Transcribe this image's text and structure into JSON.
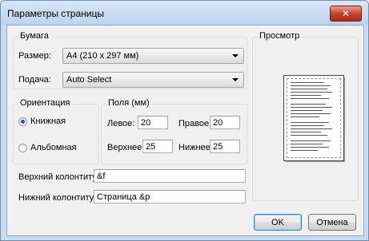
{
  "window": {
    "title": "Параметры страницы",
    "close_glyph": "✕"
  },
  "paper": {
    "legend": "Бумага",
    "size_label": "Размер:",
    "size_value": "A4 (210 x 297 мм)",
    "source_label": "Подача:",
    "source_value": "Auto Select"
  },
  "preview": {
    "legend": "Просмотр"
  },
  "orientation": {
    "legend": "Ориентация",
    "portrait": "Книжная",
    "landscape": "Альбомная",
    "selected": "portrait"
  },
  "margins": {
    "legend": "Поля (мм)",
    "left_label": "Левое:",
    "left_value": "20",
    "right_label": "Правое:",
    "right_value": "20",
    "top_label": "Верхнее:",
    "top_value": "25",
    "bottom_label": "Нижнее:",
    "bottom_value": "25"
  },
  "header": {
    "label": "Верхний колонтитул:",
    "value": "&f"
  },
  "footer": {
    "label": "Нижний колонтитул:",
    "value": "Страница &p"
  },
  "buttons": {
    "ok": "OK",
    "cancel": "Отмена"
  }
}
